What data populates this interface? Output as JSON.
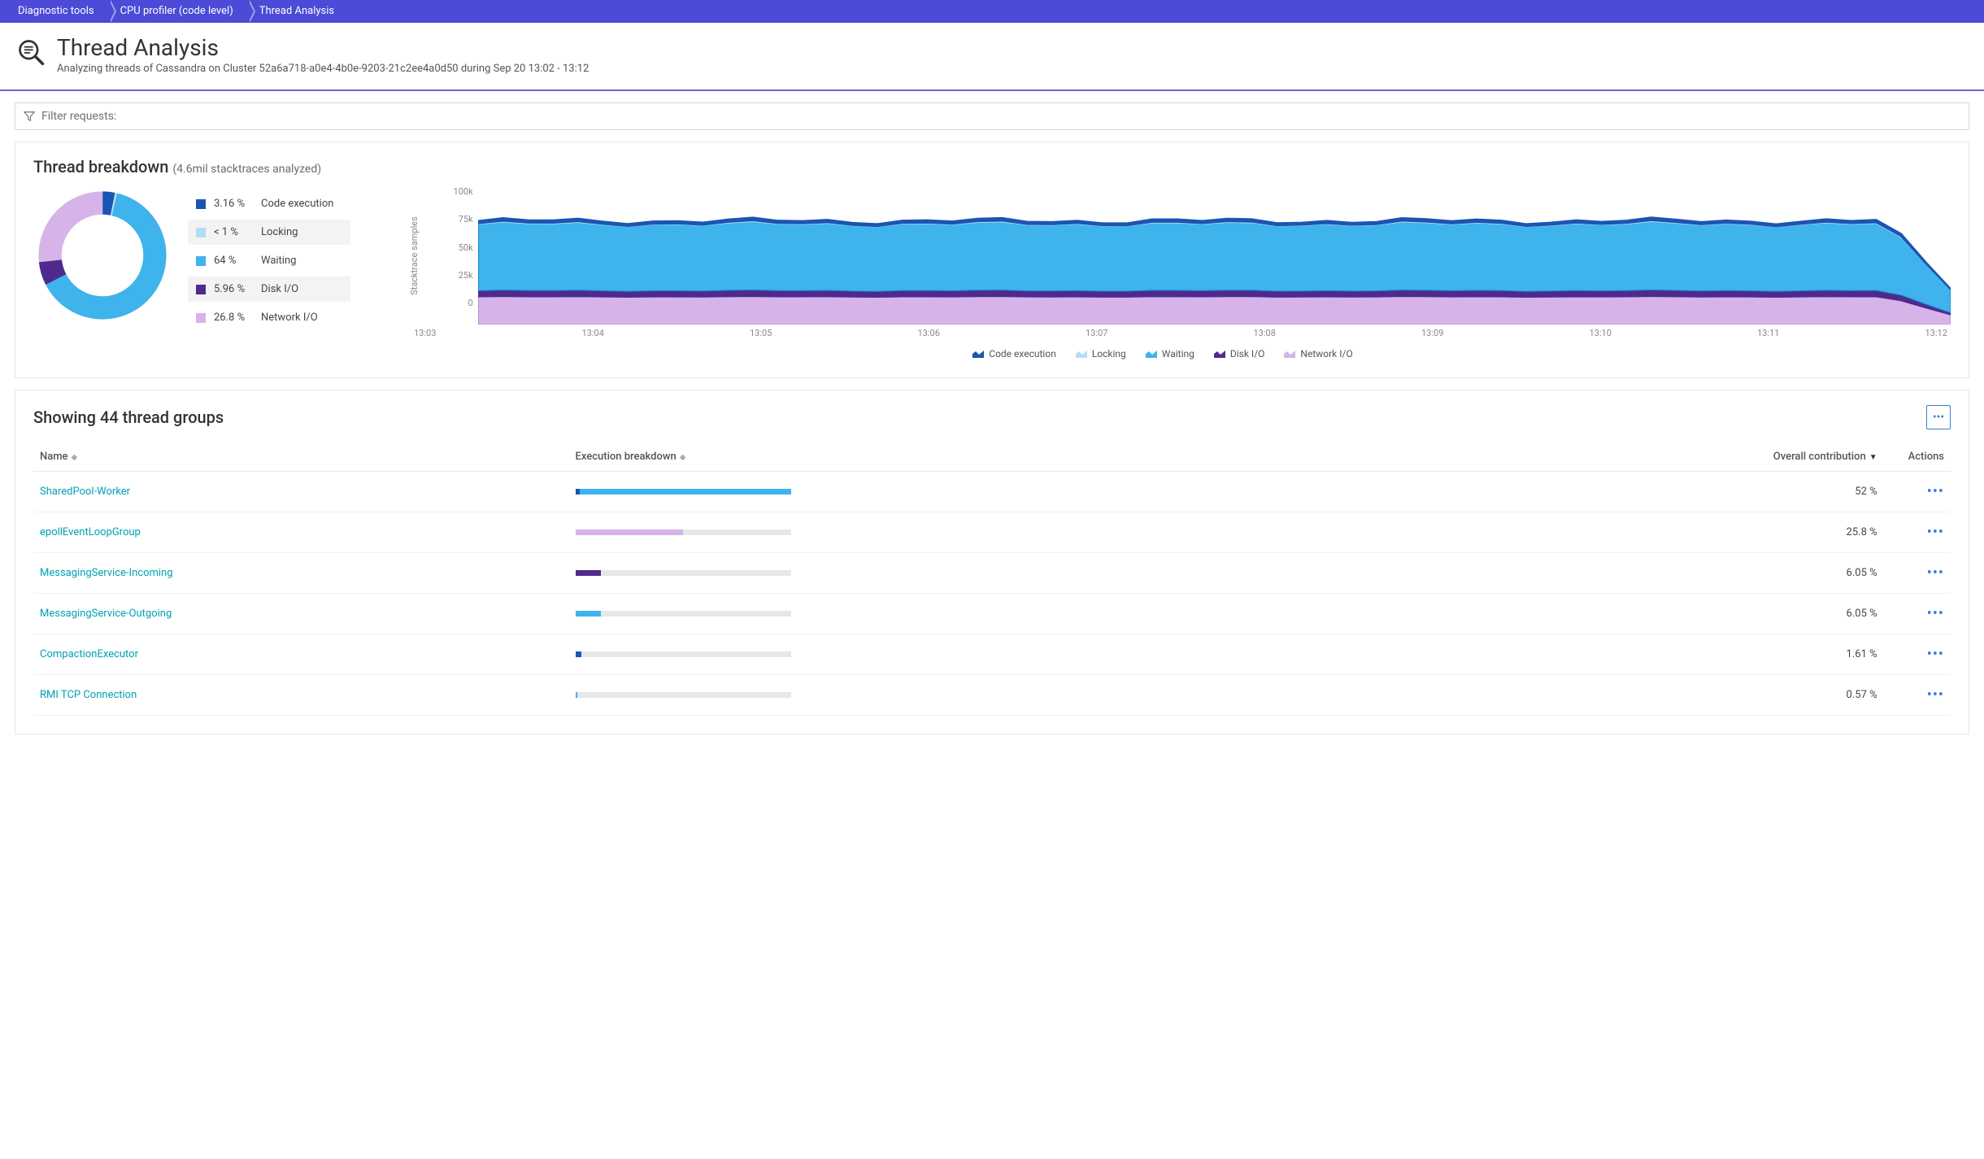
{
  "breadcrumb": [
    "Diagnostic tools",
    "CPU profiler (code level)",
    "Thread Analysis"
  ],
  "header": {
    "title": "Thread Analysis",
    "subtitle": "Analyzing threads of Cassandra on Cluster 52a6a718-a0e4-4b0e-9203-21c2ee4a0d50 during Sep 20 13:02 - 13:12"
  },
  "filter": {
    "placeholder": "Filter requests:"
  },
  "colors": {
    "code": "#1b55b3",
    "locking": "#b6dcf5",
    "waiting": "#3fb3ec",
    "diskio": "#4e2a8e",
    "network": "#d6b4ea",
    "track_bg": "#e7e7e7"
  },
  "breakdown": {
    "title": "Thread breakdown",
    "subtitle": "(4.6mil stacktraces analyzed)",
    "legend": [
      {
        "pct": "3.16 %",
        "label": "Code execution",
        "colorKey": "code",
        "shaded": false
      },
      {
        "pct": "< 1 %",
        "label": "Locking",
        "colorKey": "locking",
        "shaded": true
      },
      {
        "pct": "64 %",
        "label": "Waiting",
        "colorKey": "waiting",
        "shaded": false
      },
      {
        "pct": "5.96 %",
        "label": "Disk I/O",
        "colorKey": "diskio",
        "shaded": true
      },
      {
        "pct": "26.8 %",
        "label": "Network I/O",
        "colorKey": "network",
        "shaded": false
      }
    ],
    "donut_data": {
      "code": 3.16,
      "locking": 0.5,
      "waiting": 64,
      "diskio": 5.96,
      "network": 26.8
    }
  },
  "chart_data": {
    "type": "area",
    "ylabel": "Stacktrace samples",
    "ylim": [
      0,
      100000
    ],
    "yticks": [
      "100k",
      "75k",
      "50k",
      "25k",
      "0"
    ],
    "xticks": [
      "13:03",
      "13:04",
      "13:05",
      "13:06",
      "13:07",
      "13:08",
      "13:09",
      "13:10",
      "13:11",
      "13:12"
    ],
    "legend": [
      "Code execution",
      "Locking",
      "Waiting",
      "Disk I/O",
      "Network I/O"
    ],
    "series_approx": {
      "network": 20000,
      "diskio": 4500,
      "waiting": 48000,
      "locking": 400,
      "code": 2400,
      "total_peak": 76000,
      "drop_at_end": true
    }
  },
  "groups": {
    "title": "Showing 44 thread groups",
    "columns": {
      "name": "Name",
      "exec": "Execution breakdown",
      "contrib": "Overall contribution",
      "actions": "Actions"
    },
    "sort_active": "contrib",
    "rows": [
      {
        "name": "SharedPool-Worker",
        "contrib": "52 %",
        "segments": [
          {
            "c": "code",
            "s": 0,
            "w": 2
          },
          {
            "c": "waiting",
            "s": 2,
            "w": 98
          }
        ]
      },
      {
        "name": "epollEventLoopGroup",
        "contrib": "25.8 %",
        "segments": [
          {
            "c": "network",
            "s": 0,
            "w": 50
          }
        ]
      },
      {
        "name": "MessagingService-Incoming",
        "contrib": "6.05 %",
        "segments": [
          {
            "c": "diskio",
            "s": 0,
            "w": 12
          }
        ]
      },
      {
        "name": "MessagingService-Outgoing",
        "contrib": "6.05 %",
        "segments": [
          {
            "c": "waiting",
            "s": 0,
            "w": 12
          }
        ]
      },
      {
        "name": "CompactionExecutor",
        "contrib": "1.61 %",
        "segments": [
          {
            "c": "code",
            "s": 0,
            "w": 3
          }
        ]
      },
      {
        "name": "RMI TCP Connection",
        "contrib": "0.57 %",
        "segments": [
          {
            "c": "waiting",
            "s": 0,
            "w": 1
          }
        ]
      }
    ]
  }
}
